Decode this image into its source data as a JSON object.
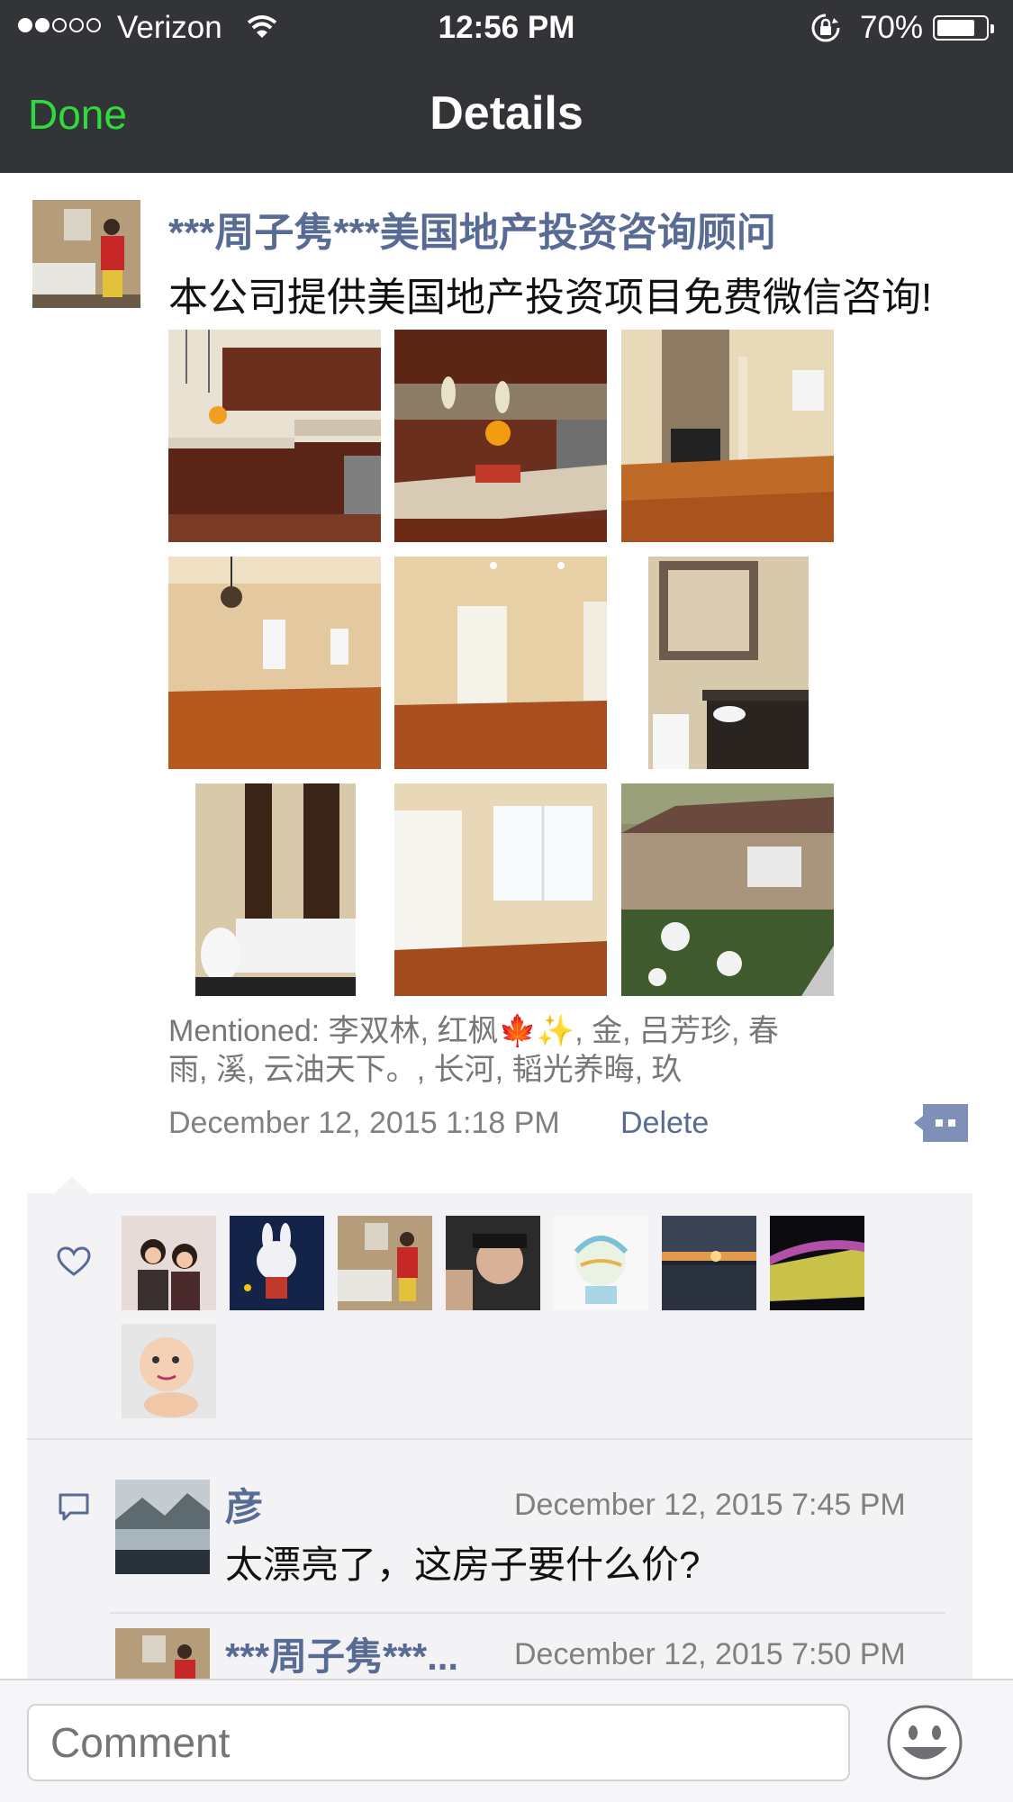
{
  "status_bar": {
    "carrier": "Verizon",
    "time": "12:56 PM",
    "battery_percent": "70%",
    "battery_level": 0.7,
    "signal_bars_filled": 2,
    "signal_bars_total": 5
  },
  "nav": {
    "done_label": "Done",
    "title": "Details"
  },
  "post": {
    "author": "***周子隽***美国地产投资咨询顾问",
    "text": "本公司提供美国地产投资项目免费微信咨询!",
    "photos": [
      "kitchen-photo",
      "kitchen-island-photo",
      "fireplace-living-room-photo",
      "dining-room-photo",
      "bedroom-door-photo",
      "bathroom-vanity-photo",
      "bathtub-photo",
      "bedroom-window-photo",
      "house-exterior-photo"
    ],
    "mentioned_line1": "Mentioned: 李双林, 红枫🍁✨, 金, 吕芳珍, 春",
    "mentioned_line2": "雨, 溪, 云油天下。, 长河, 韬光养晦, 玖",
    "timestamp": "December 12, 2015 1:18 PM",
    "delete_label": "Delete"
  },
  "likes": {
    "avatars": [
      "couple-avatar",
      "bunny-avatar",
      "man-in-bathroom-avatar",
      "selfie-avatar",
      "drawing-avatar",
      "sunset-avatar",
      "field-avatar",
      "baby-avatar"
    ]
  },
  "comments": [
    {
      "name": "彦",
      "time": "December 12, 2015 7:45 PM",
      "text": "太漂亮了，这房子要什么价?"
    },
    {
      "name": "***周子隽***...",
      "time": "December 12, 2015 7:50 PM",
      "text": ""
    }
  ],
  "comment_bar": {
    "placeholder": "Comment"
  },
  "colors": {
    "nav_background": "#333437",
    "done_green": "#2ddb3a",
    "link_blue": "#576b95",
    "panel_background": "#f3f3f5"
  }
}
